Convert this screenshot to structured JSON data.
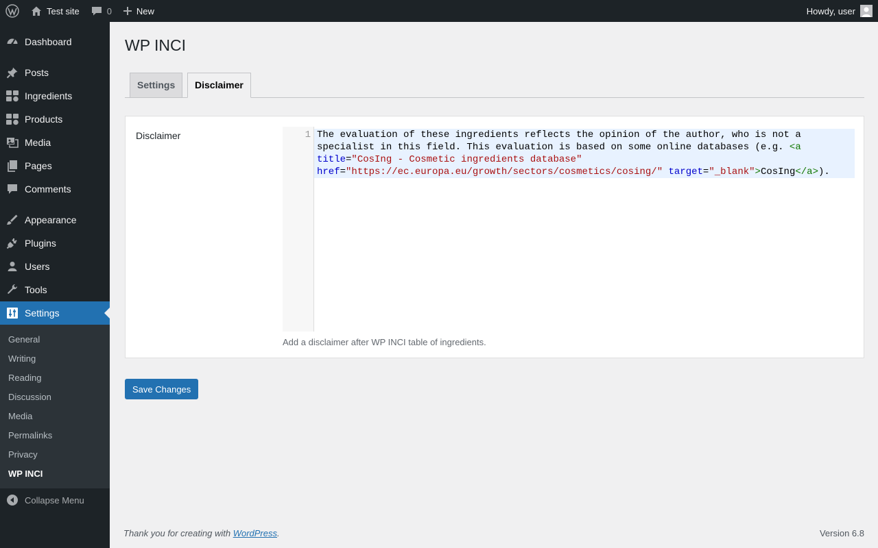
{
  "adminbar": {
    "site_name": "Test site",
    "comments_count": "0",
    "new_label": "New",
    "greeting": "Howdy, user"
  },
  "sidebar": {
    "items": [
      {
        "label": "Dashboard",
        "icon": "dashboard-icon"
      },
      {
        "label": "Posts",
        "icon": "pushpin-icon"
      },
      {
        "label": "Ingredients",
        "icon": "grid-icon"
      },
      {
        "label": "Products",
        "icon": "grid-icon"
      },
      {
        "label": "Media",
        "icon": "media-icon"
      },
      {
        "label": "Pages",
        "icon": "pages-icon"
      },
      {
        "label": "Comments",
        "icon": "comment-icon"
      },
      {
        "label": "Appearance",
        "icon": "brush-icon"
      },
      {
        "label": "Plugins",
        "icon": "plug-icon"
      },
      {
        "label": "Users",
        "icon": "user-icon"
      },
      {
        "label": "Tools",
        "icon": "wrench-icon"
      },
      {
        "label": "Settings",
        "icon": "settings-icon"
      }
    ],
    "submenu": [
      "General",
      "Writing",
      "Reading",
      "Discussion",
      "Media",
      "Permalinks",
      "Privacy",
      "WP INCI"
    ],
    "collapse_label": "Collapse Menu"
  },
  "page": {
    "title": "WP INCI",
    "tabs": [
      "Settings",
      "Disclaimer"
    ],
    "active_tab": "Disclaimer",
    "field_label": "Disclaimer",
    "line_number": "1",
    "code": {
      "text1": "The evaluation of these ingredients reflects the opinion of the author, who is not a\nspecialist in this field. This evaluation is based on some online databases (e.g. ",
      "tag_open": "<a",
      "attr_title": "title",
      "eq1": "=",
      "str_title": "\"CosIng - Cosmetic ingredients database\"",
      "attr_href": "href",
      "eq2": "=",
      "str_href": "\"https://ec.europa.eu/growth/sectors/cosmetics/cosing/\"",
      "attr_target": "target",
      "eq3": "=",
      "str_target": "\"_blank\"",
      "tag_gt": ">",
      "link_text": "CosIng",
      "tag_close": "</a>",
      "text_end": ")."
    },
    "description": "Add a disclaimer after WP INCI table of ingredients.",
    "save_label": "Save Changes"
  },
  "footer": {
    "thanks_prefix": "Thank you for creating with ",
    "thanks_link": "WordPress",
    "thanks_suffix": ".",
    "version": "Version 6.8"
  }
}
